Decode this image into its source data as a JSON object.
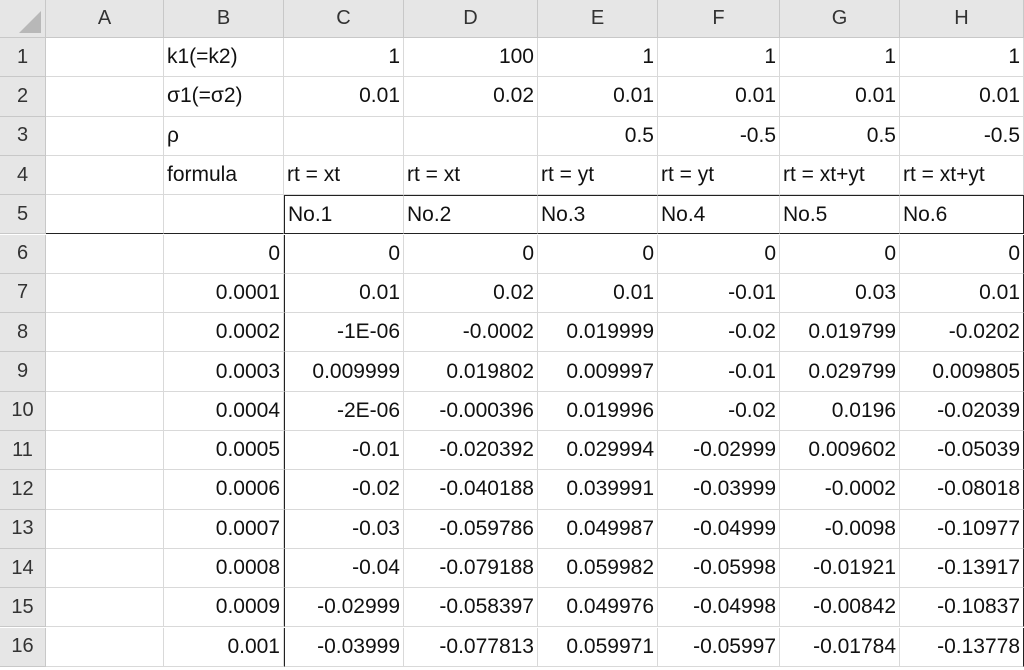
{
  "columns": [
    "A",
    "B",
    "C",
    "D",
    "E",
    "F",
    "G",
    "H"
  ],
  "rows": [
    {
      "num": "1",
      "cells": [
        "",
        "k1(=k2)",
        "1",
        "100",
        "1",
        "1",
        "1",
        "1"
      ]
    },
    {
      "num": "2",
      "cells": [
        "",
        "σ1(=σ2)",
        "0.01",
        "0.02",
        "0.01",
        "0.01",
        "0.01",
        "0.01"
      ]
    },
    {
      "num": "3",
      "cells": [
        "",
        "ρ",
        "",
        "",
        "0.5",
        "-0.5",
        "0.5",
        "-0.5"
      ]
    },
    {
      "num": "4",
      "cells": [
        "",
        "formula",
        "rt = xt",
        "rt = xt",
        "rt = yt",
        "rt = yt",
        "rt = xt+yt",
        "rt = xt+yt"
      ]
    },
    {
      "num": "5",
      "cells": [
        "",
        "",
        "No.1",
        "No.2",
        "No.3",
        "No.4",
        "No.5",
        "No.6"
      ]
    },
    {
      "num": "6",
      "cells": [
        "",
        "0",
        "0",
        "0",
        "0",
        "0",
        "0",
        "0"
      ]
    },
    {
      "num": "7",
      "cells": [
        "",
        "0.0001",
        "0.01",
        "0.02",
        "0.01",
        "-0.01",
        "0.03",
        "0.01"
      ]
    },
    {
      "num": "8",
      "cells": [
        "",
        "0.0002",
        "-1E-06",
        "-0.0002",
        "0.019999",
        "-0.02",
        "0.019799",
        "-0.0202"
      ]
    },
    {
      "num": "9",
      "cells": [
        "",
        "0.0003",
        "0.009999",
        "0.019802",
        "0.009997",
        "-0.01",
        "0.029799",
        "0.009805"
      ]
    },
    {
      "num": "10",
      "cells": [
        "",
        "0.0004",
        "-2E-06",
        "-0.000396",
        "0.019996",
        "-0.02",
        "0.0196",
        "-0.02039"
      ]
    },
    {
      "num": "11",
      "cells": [
        "",
        "0.0005",
        "-0.01",
        "-0.020392",
        "0.029994",
        "-0.02999",
        "0.009602",
        "-0.05039"
      ]
    },
    {
      "num": "12",
      "cells": [
        "",
        "0.0006",
        "-0.02",
        "-0.040188",
        "0.039991",
        "-0.03999",
        "-0.0002",
        "-0.08018"
      ]
    },
    {
      "num": "13",
      "cells": [
        "",
        "0.0007",
        "-0.03",
        "-0.059786",
        "0.049987",
        "-0.04999",
        "-0.0098",
        "-0.10977"
      ]
    },
    {
      "num": "14",
      "cells": [
        "",
        "0.0008",
        "-0.04",
        "-0.079188",
        "0.059982",
        "-0.05998",
        "-0.01921",
        "-0.13917"
      ]
    },
    {
      "num": "15",
      "cells": [
        "",
        "0.0009",
        "-0.02999",
        "-0.058397",
        "0.049976",
        "-0.04998",
        "-0.00842",
        "-0.10837"
      ]
    },
    {
      "num": "16",
      "cells": [
        "",
        "0.001",
        "-0.03999",
        "-0.077813",
        "0.059971",
        "-0.05997",
        "-0.01784",
        "-0.13778"
      ]
    }
  ]
}
